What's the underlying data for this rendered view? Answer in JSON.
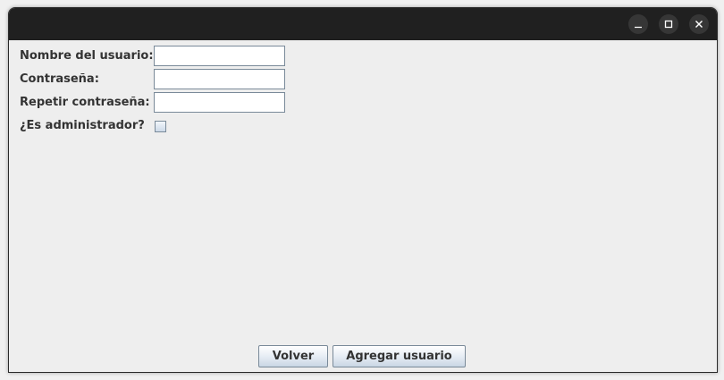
{
  "window": {
    "title": "",
    "controls": {
      "minimize_icon": "minimize-icon",
      "maximize_icon": "maximize-icon",
      "close_icon": "close-icon"
    }
  },
  "form": {
    "username_label": "Nombre del usuario:",
    "username_value": "",
    "password_label": "Contraseña:",
    "password_value": "",
    "repeat_password_label": "Repetir contraseña:",
    "repeat_password_value": "",
    "is_admin_label": "¿Es administrador?",
    "is_admin_checked": false
  },
  "actions": {
    "back_label": "Volver",
    "add_user_label": "Agregar usuario"
  },
  "colors": {
    "titlebar": "#202020",
    "background": "#eeeeee",
    "field_border": "#7a8a99",
    "text": "#333333"
  }
}
